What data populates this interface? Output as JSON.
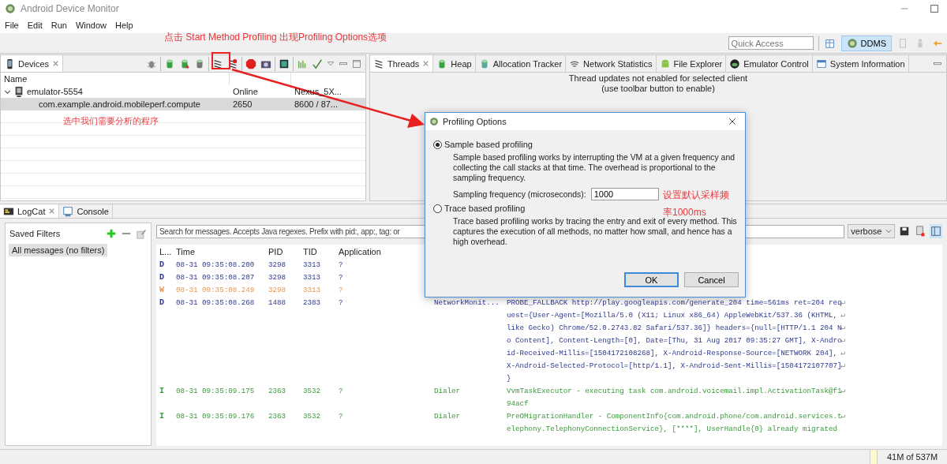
{
  "window": {
    "title": "Android Device Monitor"
  },
  "menu": [
    "File",
    "Edit",
    "Run",
    "Window",
    "Help"
  ],
  "toolbar": {
    "quick_access_placeholder": "Quick Access",
    "perspective": {
      "label": "DDMS",
      "selected": true
    }
  },
  "devices_panel": {
    "tab": {
      "label": "Devices",
      "selected": true
    },
    "columns": [
      "Name"
    ],
    "devices": [
      {
        "name": "emulator-5554",
        "status": "Online",
        "target": "Nexus_5X...",
        "expanded": true,
        "children": [
          {
            "name": "com.example.android.mobileperf.compute",
            "pid": "2650",
            "ports": "8600 / 87...",
            "selected": true
          }
        ]
      }
    ]
  },
  "tool_tabs": [
    {
      "label": "Threads",
      "selected": true
    },
    {
      "label": "Heap",
      "selected": false
    },
    {
      "label": "Allocation Tracker",
      "selected": false
    },
    {
      "label": "Network Statistics",
      "selected": false
    },
    {
      "label": "File Explorer",
      "selected": false
    },
    {
      "label": "Emulator Control",
      "selected": false
    },
    {
      "label": "System Information",
      "selected": false
    }
  ],
  "threads_message": [
    "Thread updates not enabled for selected client",
    "(use toolbar button to enable)"
  ],
  "bottom_tabs": [
    {
      "label": "LogCat",
      "selected": true
    },
    {
      "label": "Console",
      "selected": false
    }
  ],
  "saved_filters": {
    "title": "Saved Filters",
    "items": [
      {
        "label": "All messages (no filters)",
        "selected": true
      }
    ]
  },
  "logcat": {
    "search_placeholder": "Search for messages. Accepts Java regexes. Prefix with pid:, app:, tag: or",
    "level_filter": "verbose",
    "columns": [
      "L...",
      "Time",
      "PID",
      "TID",
      "Application"
    ],
    "rows": [
      {
        "level": "D",
        "color": "#2f3a8f",
        "time": "08-31 09:35:08.200",
        "pid": "3298",
        "tid": "3313",
        "application": "?"
      },
      {
        "level": "D",
        "color": "#2f3a8f",
        "time": "08-31 09:35:08.207",
        "pid": "3298",
        "tid": "3313",
        "application": "?"
      },
      {
        "level": "W",
        "color": "#e8964f",
        "time": "08-31 09:35:08.249",
        "pid": "3298",
        "tid": "3313",
        "application": "?"
      },
      {
        "level": "D",
        "color": "#2f3a8f",
        "time": "08-31 09:35:08.268",
        "pid": "1488",
        "tid": "2383",
        "application": "?",
        "tag": "NetworkMonit...",
        "message_lines": [
          "PROBE_FALLBACK http://play.googleapis.com/generate_204 time=561ms ret=204 req",
          "uest={User-Agent=[Mozilla/5.0 (X11; Linux x86_64) AppleWebKit/537.36 (KHTML,",
          "like Gecko) Chrome/52.0.2743.82 Safari/537.36]} headers={null=[HTTP/1.1 204 N",
          "o Content], Content-Length=[0], Date=[Thu, 31 Aug 2017 09:35:27 GMT], X-Andro",
          "id-Received-Millis=[1504172108268], X-Android-Response-Source=[NETWORK 204],",
          "X-Android-Selected-Protocol=[http/1.1], X-Android-Sent-Millis=[1504172107707]",
          "}"
        ]
      },
      {
        "level": "I",
        "color": "#3d9a3d",
        "time": "08-31 09:35:09.175",
        "pid": "2363",
        "tid": "3532",
        "application": "?",
        "tag": "Dialer",
        "message_lines": [
          "VvmTaskExecutor - executing task com.android.voicemail.impl.ActivationTask@f1",
          "94acf"
        ]
      },
      {
        "level": "I",
        "color": "#3d9a3d",
        "time": "08-31 09:35:09.176",
        "pid": "2363",
        "tid": "3532",
        "application": "?",
        "tag": "Dialer",
        "message_lines": [
          "PreOMigrationHandler - ComponentInfo{com.android.phone/com.android.services.t",
          "elephony.TelephonyConnectionService}, [****], UserHandle{0} already migrated"
        ]
      }
    ]
  },
  "dialog": {
    "title": "Profiling Options",
    "options": [
      {
        "label": "Sample based profiling",
        "selected": true,
        "description": "Sample based profiling works by interrupting the VM at a given frequency and collecting the call stacks at that time. The overhead is proportional to the sampling frequency.",
        "field": {
          "label": "Sampling frequency (microseconds):",
          "value": "1000"
        }
      },
      {
        "label": "Trace based profiling",
        "selected": false,
        "description": "Trace based profiling works by tracing the entry and exit of every method. This captures the execution of all methods, no matter how small, and hence has a high overhead."
      }
    ],
    "buttons": [
      {
        "label": "OK",
        "default": true
      },
      {
        "label": "Cancel",
        "default": false
      }
    ]
  },
  "annotations": [
    "点击 Start Method Profiling 出现Profiling Options选项",
    "选中我们需要分析的程序",
    "设置默认采样频率1000ms"
  ],
  "status_bar": {
    "memory": "41M of 537M"
  }
}
